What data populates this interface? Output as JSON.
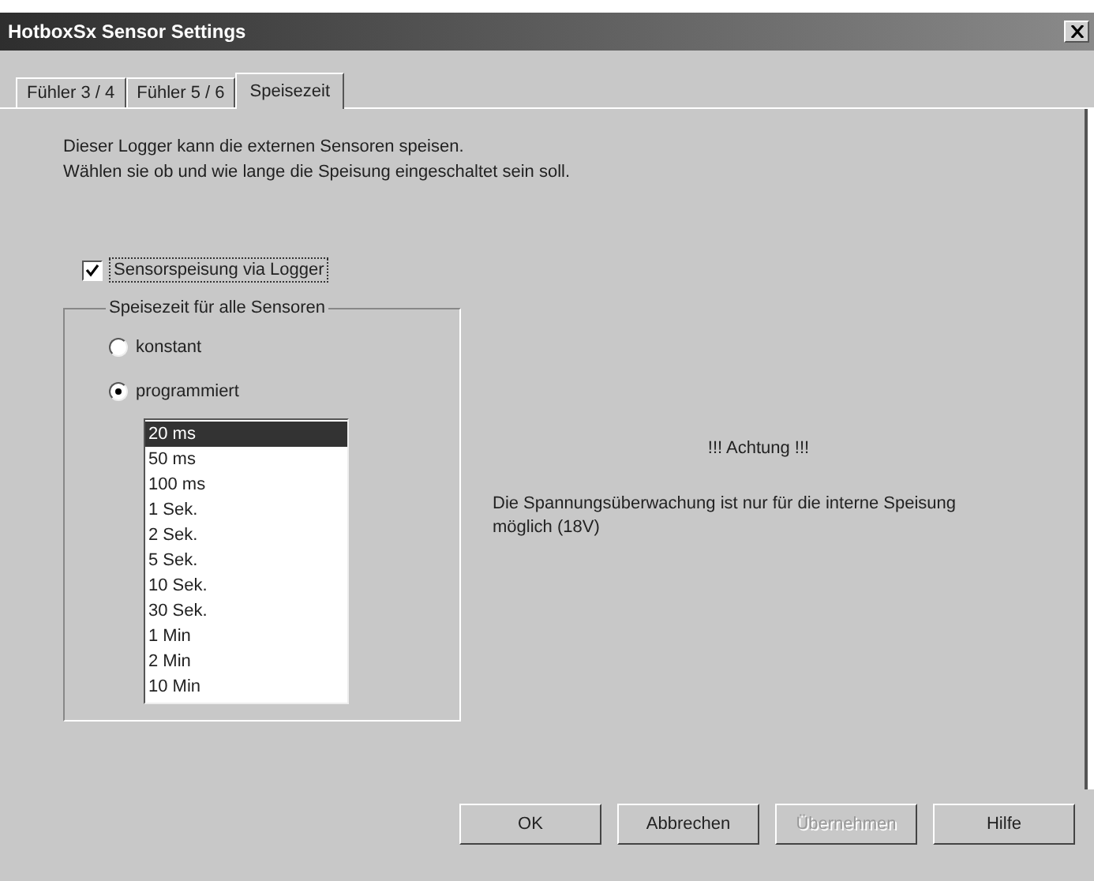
{
  "window": {
    "title": "HotboxSx Sensor Settings"
  },
  "tabs": [
    {
      "label": "Fühler 3 / 4",
      "selected": false
    },
    {
      "label": "Fühler 5 / 6",
      "selected": false
    },
    {
      "label": "Speisezeit",
      "selected": true
    }
  ],
  "intro": [
    "Dieser Logger kann die externen Sensoren speisen.",
    "Wählen sie ob und wie lange die Speisung eingeschaltet sein soll."
  ],
  "supply_checkbox": {
    "label": "Sensorspeisung via Logger",
    "checked": true
  },
  "group": {
    "title": "Speisezeit für alle Sensoren",
    "radios": [
      {
        "label": "konstant",
        "selected": false
      },
      {
        "label": "programmiert",
        "selected": true
      }
    ],
    "list": [
      {
        "label": "20 ms",
        "selected": true
      },
      {
        "label": "50 ms",
        "selected": false
      },
      {
        "label": "100 ms",
        "selected": false
      },
      {
        "label": "1 Sek.",
        "selected": false
      },
      {
        "label": "2 Sek.",
        "selected": false
      },
      {
        "label": "5 Sek.",
        "selected": false
      },
      {
        "label": "10 Sek.",
        "selected": false
      },
      {
        "label": "30 Sek.",
        "selected": false
      },
      {
        "label": "1 Min",
        "selected": false
      },
      {
        "label": "2 Min",
        "selected": false
      },
      {
        "label": "10 Min",
        "selected": false
      }
    ]
  },
  "warning": {
    "heading": "!!! Achtung !!!",
    "text": "Die Spannungsüberwachung ist nur für die interne Speisung möglich (18V)"
  },
  "buttons": [
    {
      "label": "OK",
      "disabled": false
    },
    {
      "label": "Abbrechen",
      "disabled": false
    },
    {
      "label": "Übernehmen",
      "disabled": true
    },
    {
      "label": "Hilfe",
      "disabled": false
    }
  ]
}
